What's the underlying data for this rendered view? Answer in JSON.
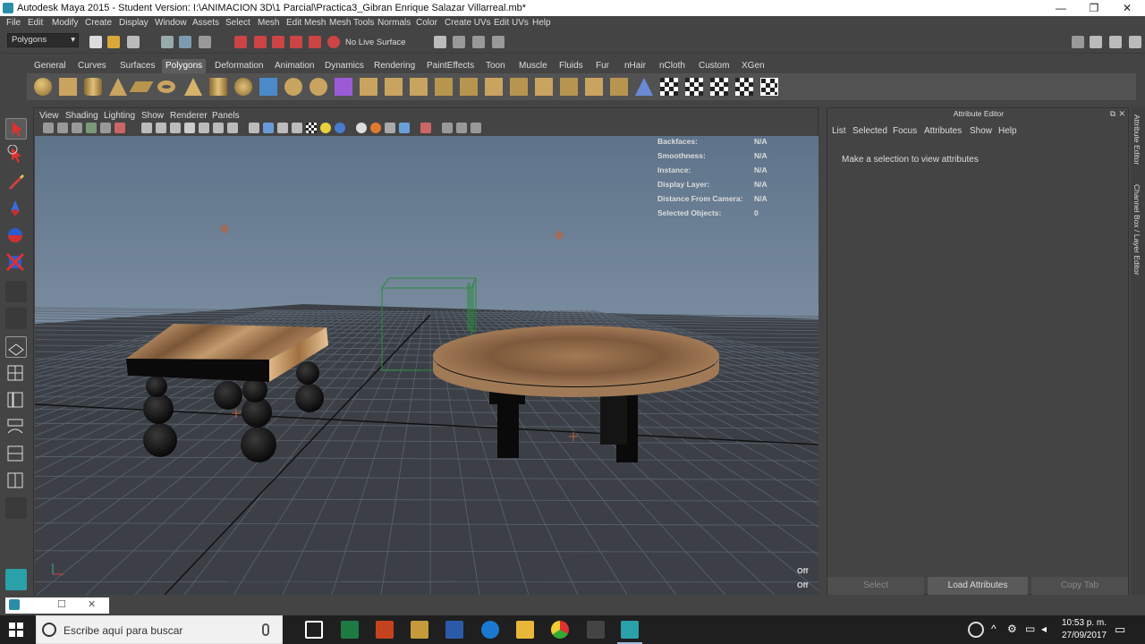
{
  "window": {
    "title": "Autodesk Maya 2015 - Student Version: I:\\ANIMACION 3D\\1 Parcial\\Practica3_Gibran Enrique Salazar Villarreal.mb*",
    "minimize": "—",
    "maximize": "❐",
    "close": "✕"
  },
  "menubar": [
    "File",
    "Edit",
    "Modify",
    "Create",
    "Display",
    "Window",
    "Assets",
    "Select",
    "Mesh",
    "Edit Mesh",
    "Mesh Tools",
    "Normals",
    "Color",
    "Create UVs",
    "Edit UVs",
    "Help"
  ],
  "statusline": {
    "mode_menu": "Polygons",
    "live_surface": "No Live Surface"
  },
  "shelf": {
    "tabs": [
      "General",
      "Curves",
      "Surfaces",
      "Polygons",
      "Deformation",
      "Animation",
      "Dynamics",
      "Rendering",
      "PaintEffects",
      "Toon",
      "Muscle",
      "Fluids",
      "Fur",
      "nHair",
      "nCloth",
      "Custom",
      "XGen"
    ],
    "active_tab": "Polygons"
  },
  "viewport": {
    "menu": [
      "View",
      "Shading",
      "Lighting",
      "Show",
      "Renderer",
      "Panels"
    ],
    "hud": [
      {
        "label": "Backfaces:",
        "value": "N/A"
      },
      {
        "label": "Smoothness:",
        "value": "N/A"
      },
      {
        "label": "Instance:",
        "value": "N/A"
      },
      {
        "label": "Display Layer:",
        "value": "N/A"
      },
      {
        "label": "Distance From Camera:",
        "value": "N/A"
      },
      {
        "label": "Selected Objects:",
        "value": "0"
      }
    ],
    "off_1": "Off",
    "off_2": "Off",
    "colors": {
      "sky_top": "#5e738a",
      "sky_bottom": "#a2b0be",
      "grid_line": "#5a6470",
      "ground": "#3c4046"
    }
  },
  "attribute_editor": {
    "title": "Attribute Editor",
    "menu": [
      "List",
      "Selected",
      "Focus",
      "Attributes",
      "Show",
      "Help"
    ],
    "message": "Make a selection to view attributes",
    "buttons": {
      "select": "Select",
      "load": "Load Attributes",
      "copy": "Copy Tab"
    }
  },
  "side_tabs": {
    "tab1": "Attribute Editor",
    "tab2": "Channel Box / Layer Editor"
  },
  "taskbar": {
    "search_placeholder": "Escribe aquí para buscar",
    "time": "10:53 p. m.",
    "date": "27/09/2017"
  }
}
